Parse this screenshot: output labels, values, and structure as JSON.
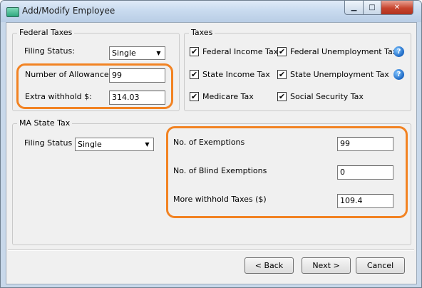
{
  "window": {
    "title": "Add/Modify Employee"
  },
  "titlebar_buttons": {
    "minimize": "▁",
    "maximize": "□",
    "close": "✕"
  },
  "federal_taxes": {
    "group_title": "Federal Taxes",
    "filing_status_label": "Filing Status:",
    "filing_status_value": "Single",
    "allowance_label": "Number of Allowance:",
    "allowance_value": "99",
    "extra_withhold_label": "Extra withhold $:",
    "extra_withhold_value": "314.03"
  },
  "taxes": {
    "group_title": "Taxes",
    "items": [
      {
        "label": "Federal Income Tax",
        "checked": true
      },
      {
        "label": "Federal Unemployment Tax",
        "checked": true,
        "help": "?"
      },
      {
        "label": "State Income Tax",
        "checked": true
      },
      {
        "label": "State Unemployment Tax",
        "checked": true,
        "help": "?"
      },
      {
        "label": "Medicare Tax",
        "checked": true
      },
      {
        "label": "Social Security Tax",
        "checked": true
      }
    ],
    "check_mark": "✔"
  },
  "ma_state_tax": {
    "group_title": "MA State Tax",
    "filing_status_label": "Filing Status",
    "filing_status_value": "Single",
    "exemptions_label": "No. of Exemptions",
    "exemptions_value": "99",
    "blind_exemptions_label": "No. of Blind Exemptions",
    "blind_exemptions_value": "0",
    "more_withhold_label": "More withhold Taxes ($)",
    "more_withhold_value": "109.4"
  },
  "buttons": {
    "back": "< Back",
    "next": "Next >",
    "cancel": "Cancel"
  },
  "colors": {
    "highlight": "#f28323",
    "help_icon": "#1c68c4",
    "close_button": "#c7442e"
  }
}
